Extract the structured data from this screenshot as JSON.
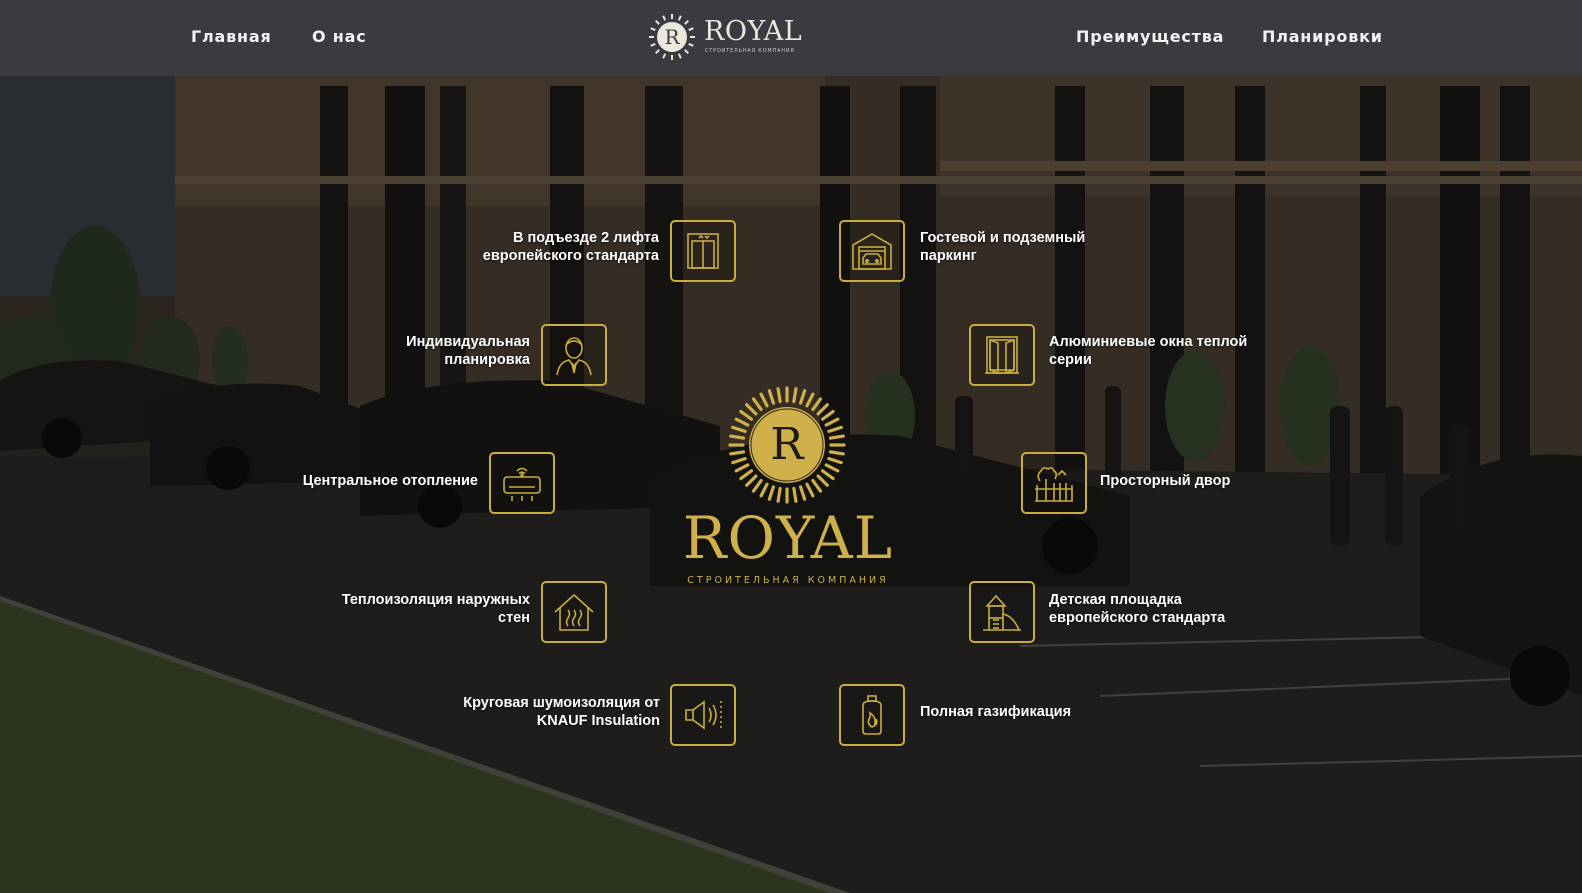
{
  "header": {
    "nav_left": [
      "Главная",
      "О нас"
    ],
    "nav_right": [
      "Преимущества",
      "Планировки"
    ],
    "logo": {
      "letter": "R",
      "name": "ROYAL",
      "tagline": "СТРОИТЕЛЬНАЯ КОМПАНИЯ"
    }
  },
  "center_logo": {
    "letter": "R",
    "name": "ROYAL",
    "tagline": "СТРОИТЕЛЬНАЯ КОМПАНИЯ"
  },
  "features": {
    "elevators": {
      "icon": "elevator-icon",
      "label": "В подъезде 2 лифта\nевропейского стандарта"
    },
    "parking": {
      "icon": "garage-icon",
      "label": "Гостевой и подземный\nпаркинг"
    },
    "planning": {
      "icon": "person-icon",
      "label": "Индивидуальная\nпланировка"
    },
    "windows": {
      "icon": "window-icon",
      "label": "Алюминиевые окна теплой\nсерии"
    },
    "heating": {
      "icon": "heater-icon",
      "label": "Центральное отопление"
    },
    "yard": {
      "icon": "yard-icon",
      "label": "Просторный двор"
    },
    "insulation": {
      "icon": "house-heat-icon",
      "label": "Теплоизоляция наружных\nстен"
    },
    "playground": {
      "icon": "playground-icon",
      "label": "Детская площадка\nевропейского стандарта"
    },
    "soundproof": {
      "icon": "speaker-icon",
      "label": "Круговая шумоизоляция от\nKNAUF Insulation"
    },
    "gas": {
      "icon": "gas-cylinder-icon",
      "label": "Полная газификация"
    }
  },
  "colors": {
    "gold": "#c9ad3f",
    "header_bg": "#3a3a40",
    "text": "#ffffff"
  }
}
